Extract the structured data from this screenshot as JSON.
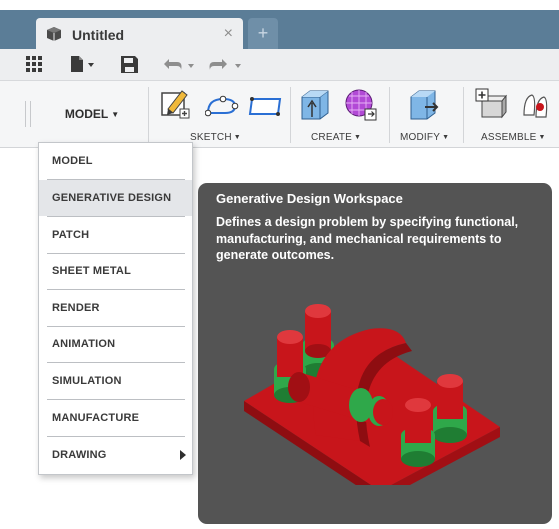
{
  "window": {
    "tab_title": "Untitled",
    "tab_close": "×",
    "new_tab": "+"
  },
  "quick_access": {
    "icons": [
      "grid-icon",
      "file-icon",
      "save-icon",
      "undo-icon",
      "redo-icon"
    ]
  },
  "ribbon": {
    "workspace_label": "MODEL",
    "groups": [
      {
        "label": "SKETCH"
      },
      {
        "label": "CREATE"
      },
      {
        "label": "MODIFY"
      },
      {
        "label": "ASSEMBLE"
      }
    ]
  },
  "dropdown": {
    "items": [
      {
        "label": "MODEL"
      },
      {
        "label": "GENERATIVE DESIGN"
      },
      {
        "label": "PATCH"
      },
      {
        "label": "SHEET METAL"
      },
      {
        "label": "RENDER"
      },
      {
        "label": "ANIMATION"
      },
      {
        "label": "SIMULATION"
      },
      {
        "label": "MANUFACTURE"
      },
      {
        "label": "DRAWING"
      }
    ],
    "highlighted": "GENERATIVE DESIGN"
  },
  "tooltip": {
    "title": "Generative Design Workspace",
    "description": "Defines a design problem by specifying functional, manufacturing, and mechanical requirements to generate outcomes."
  },
  "colors": {
    "titlebar": "#5b7d97",
    "part_red": "#c8151b",
    "part_green": "#2fa84a",
    "tooltip_bg": "#545454"
  }
}
